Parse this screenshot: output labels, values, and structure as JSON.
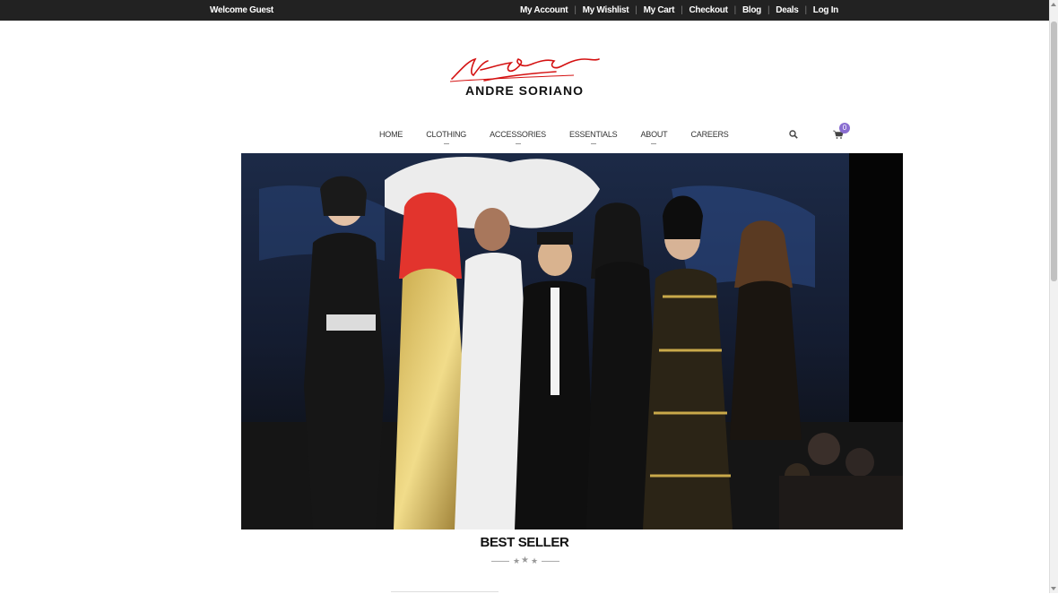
{
  "topbar": {
    "welcome": "Welcome Guest",
    "links": [
      "My Account",
      "My Wishlist",
      "My Cart",
      "Checkout",
      "Blog",
      "Deals",
      "Log In"
    ]
  },
  "logo": {
    "brand_text": "ANDRE SORIANO"
  },
  "nav": {
    "items": [
      "HOME",
      "CLOTHING",
      "ACCESSORIES",
      "ESSENTIALS",
      "ABOUT",
      "CAREERS"
    ]
  },
  "cart": {
    "count": "0"
  },
  "section": {
    "title": "BEST SELLER"
  },
  "colors": {
    "topbar_bg": "#222222",
    "badge": "#8a6ed1",
    "logo_red": "#d41111"
  }
}
